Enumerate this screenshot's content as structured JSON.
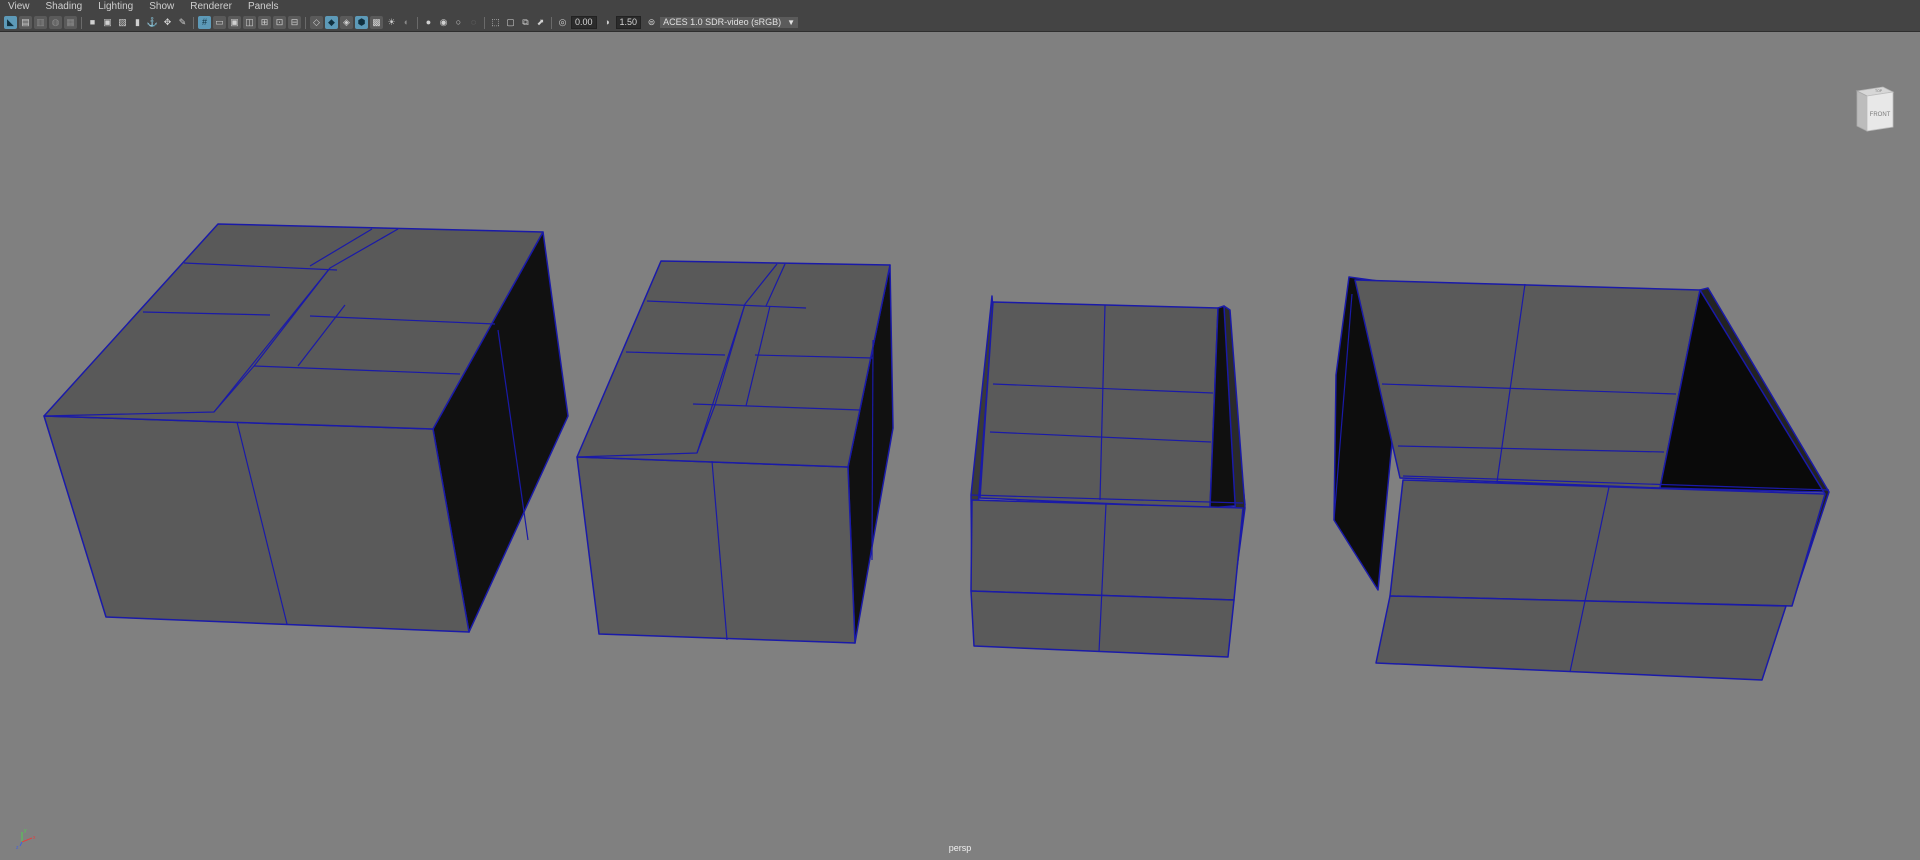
{
  "menubar": {
    "items": [
      "View",
      "Shading",
      "Lighting",
      "Show",
      "Renderer",
      "Panels"
    ]
  },
  "toolbar": {
    "exposure_value": "0.00",
    "gamma_value": "1.50",
    "color_space": "ACES 1.0 SDR-video (sRGB)"
  },
  "viewcube": {
    "top_label": "TOP",
    "front_label": "FRONT"
  },
  "viewport": {
    "camera_label": "persp",
    "background_color": "#808080",
    "wireframe_color": "#1a1aa8"
  },
  "axis_indicator": {
    "x_label": "x",
    "y_label": "y",
    "z_label": "z"
  }
}
